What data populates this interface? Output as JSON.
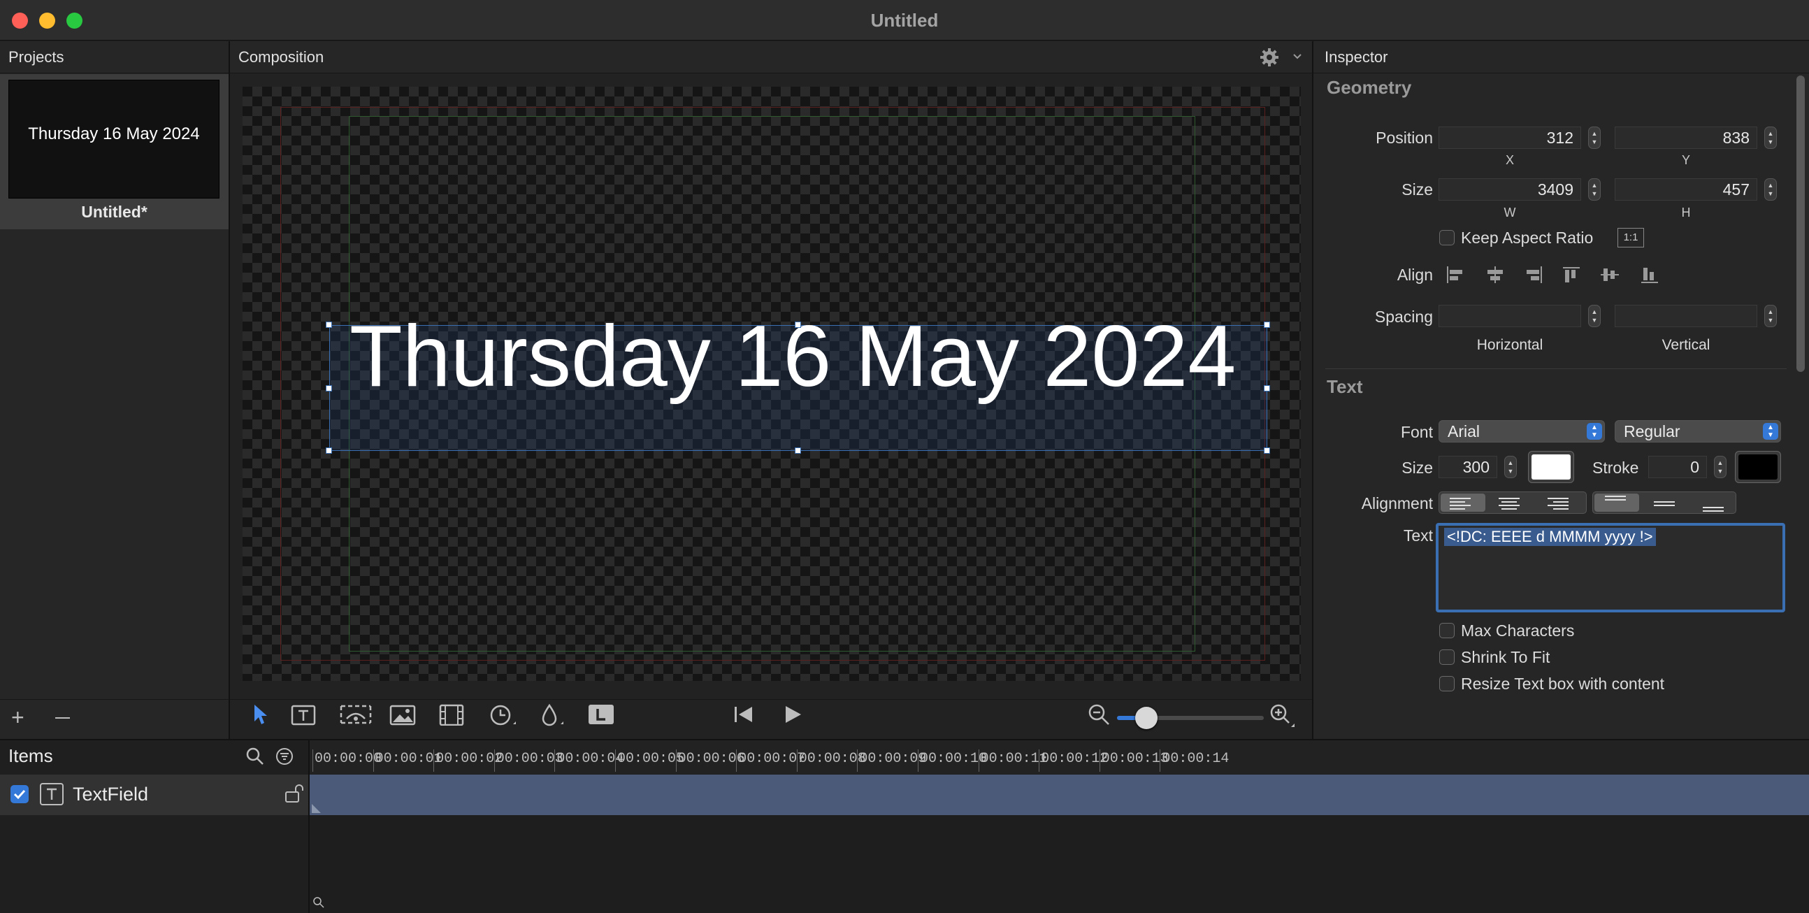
{
  "window": {
    "title": "Untitled"
  },
  "projects": {
    "header": "Projects",
    "items": [
      {
        "thumb_text": "Thursday 16 May 2024",
        "label": "Untitled*"
      }
    ]
  },
  "composition": {
    "header": "Composition",
    "canvas_text": "Thursday 16 May 2024"
  },
  "inspector": {
    "header": "Inspector",
    "geometry": {
      "title": "Geometry",
      "position_label": "Position",
      "x": "312",
      "y": "838",
      "x_label": "X",
      "y_label": "Y",
      "size_label": "Size",
      "w": "3409",
      "h": "457",
      "w_label": "W",
      "h_label": "H",
      "keep_aspect_label": "Keep Aspect Ratio",
      "ratio_label": "1:1",
      "align_label": "Align",
      "spacing_label": "Spacing",
      "horizontal_label": "Horizontal",
      "vertical_label": "Vertical"
    },
    "text": {
      "title": "Text",
      "font_label": "Font",
      "font": "Arial",
      "style": "Regular",
      "size_label": "Size",
      "size": "300",
      "stroke_label": "Stroke",
      "stroke": "0",
      "alignment_label": "Alignment",
      "text_label": "Text",
      "text_value": "<!DC: EEEE d MMMM yyyy !>",
      "max_chars_label": "Max Characters",
      "shrink_label": "Shrink To Fit",
      "resize_label": "Resize Text box with content",
      "fill_color": "#ffffff",
      "stroke_color": "#000000"
    }
  },
  "items": {
    "header": "Items",
    "rows": [
      {
        "label": "TextField",
        "checked": true
      }
    ]
  },
  "timeline": {
    "ticks": [
      "00:00:00",
      "00:00:01",
      "00:00:02",
      "00:00:03",
      "00:00:04",
      "00:00:05",
      "00:00:06",
      "00:00:07",
      "00:00:08",
      "00:00:09",
      "00:00:10",
      "00:00:11",
      "00:00:12",
      "00:00:13",
      "00:00:14"
    ]
  },
  "colors": {
    "accent": "#3478d8",
    "selection": "#3b6fb3",
    "track": "#4a5a78"
  },
  "playback": {
    "zoom_level": 0.2
  }
}
